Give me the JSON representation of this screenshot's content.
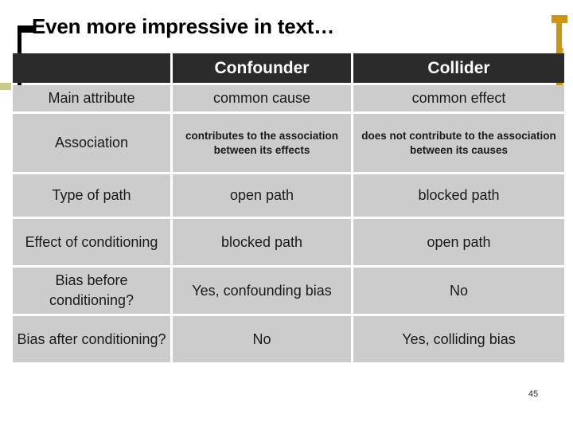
{
  "slide": {
    "title": "Even more impressive in text…",
    "number": "45",
    "colors": {
      "header_bg": "#2b2b2b",
      "cell_bg": "#cccccc",
      "accent_gold": "#cf9512",
      "accent_olive": "#cfc98a",
      "text": "#1a1a1a",
      "header_text": "#ffffff",
      "background": "#ffffff"
    }
  },
  "table": {
    "columns": [
      {
        "key": "attribute",
        "label": ""
      },
      {
        "key": "confounder",
        "label": "Confounder"
      },
      {
        "key": "collider",
        "label": "Collider"
      }
    ],
    "rows": [
      {
        "attribute": "Main attribute",
        "confounder": "common cause",
        "collider": "common effect",
        "small": false
      },
      {
        "attribute": "Association",
        "confounder": "contributes to the association between its effects",
        "collider": "does not contribute to the association between its causes",
        "small": true
      },
      {
        "attribute": "Type of path",
        "confounder": "open path",
        "collider": "blocked path",
        "small": false
      },
      {
        "attribute": "Effect of conditioning",
        "confounder": "blocked path",
        "collider": "open path",
        "small": false
      },
      {
        "attribute": "Bias before conditioning?",
        "confounder": "Yes, confounding bias",
        "collider": "No",
        "small": false
      },
      {
        "attribute": "Bias after conditioning?",
        "confounder": "No",
        "collider": "Yes, colliding bias",
        "small": false
      }
    ]
  }
}
